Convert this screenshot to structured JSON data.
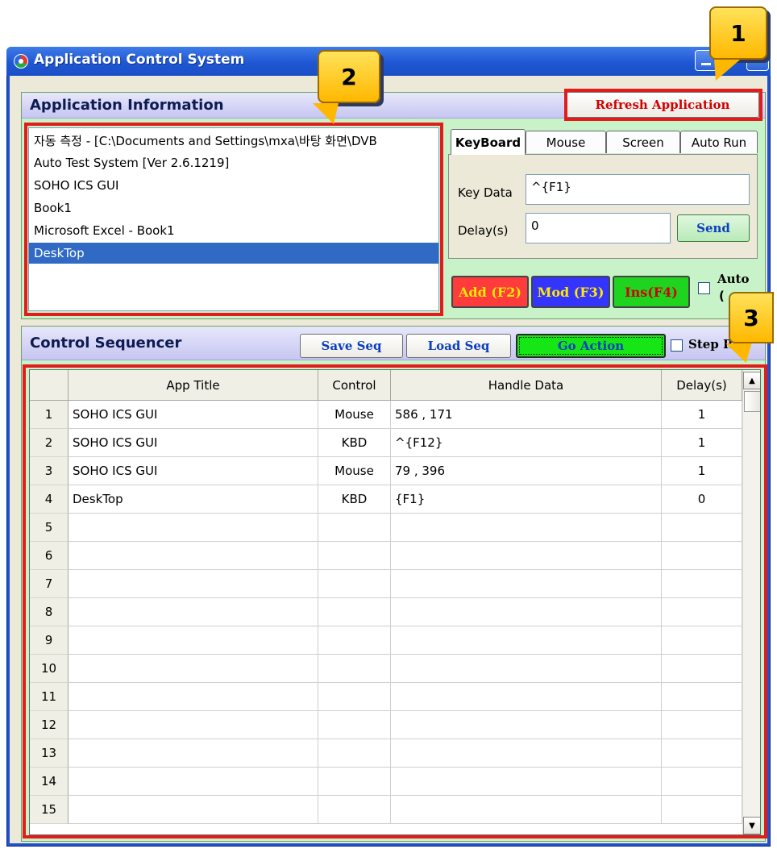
{
  "window": {
    "title": "Application Control System"
  },
  "app_info": {
    "header": "Application Information",
    "refresh_label": "Refresh Application",
    "apps": [
      {
        "label": "자동 측정 - [C:\\Documents and Settings\\mxa\\바탕 화면\\DVB"
      },
      {
        "label": "Auto Test System [Ver 2.6.1219]"
      },
      {
        "label": "SOHO ICS GUI"
      },
      {
        "label": "Book1"
      },
      {
        "label": "Microsoft Excel - Book1"
      },
      {
        "label": "DeskTop",
        "selected": true
      }
    ]
  },
  "tabs": [
    {
      "label": "KeyBoard",
      "active": true
    },
    {
      "label": "Mouse"
    },
    {
      "label": "Screen"
    },
    {
      "label": "Auto Run"
    }
  ],
  "keyboard": {
    "key_data_label": "Key Data",
    "key_data_value": "^{F1}",
    "delay_label": "Delay(s)",
    "delay_value": "0",
    "send_label": "Send"
  },
  "actions": {
    "add_label": "Add (F2)",
    "mod_label": "Mod (F3)",
    "ins_label": "Ins(F4)",
    "auto_label": "Auto",
    "auto_sub": "("
  },
  "sequencer": {
    "header": "Control Sequencer",
    "save_label": "Save Seq",
    "load_label": "Load Seq",
    "go_label": "Go Action",
    "step_label": "Step Run",
    "columns": [
      "App Title",
      "Control",
      "Handle Data",
      "Delay(s)"
    ],
    "rows": [
      {
        "no": "1",
        "app": "SOHO ICS GUI",
        "control": "Mouse",
        "handle": "586 , 171",
        "delay": "1"
      },
      {
        "no": "2",
        "app": "SOHO ICS GUI",
        "control": "KBD",
        "handle": "^{F12}",
        "delay": "1"
      },
      {
        "no": "3",
        "app": "SOHO ICS GUI",
        "control": "Mouse",
        "handle": "79 , 396",
        "delay": "1"
      },
      {
        "no": "4",
        "app": "DeskTop",
        "control": "KBD",
        "handle": "{F1}",
        "delay": "0"
      },
      {
        "no": "5",
        "app": "",
        "control": "",
        "handle": "",
        "delay": ""
      },
      {
        "no": "6",
        "app": "",
        "control": "",
        "handle": "",
        "delay": ""
      },
      {
        "no": "7",
        "app": "",
        "control": "",
        "handle": "",
        "delay": ""
      },
      {
        "no": "8",
        "app": "",
        "control": "",
        "handle": "",
        "delay": ""
      },
      {
        "no": "9",
        "app": "",
        "control": "",
        "handle": "",
        "delay": ""
      },
      {
        "no": "10",
        "app": "",
        "control": "",
        "handle": "",
        "delay": ""
      },
      {
        "no": "11",
        "app": "",
        "control": "",
        "handle": "",
        "delay": ""
      },
      {
        "no": "12",
        "app": "",
        "control": "",
        "handle": "",
        "delay": ""
      },
      {
        "no": "13",
        "app": "",
        "control": "",
        "handle": "",
        "delay": ""
      },
      {
        "no": "14",
        "app": "",
        "control": "",
        "handle": "",
        "delay": ""
      },
      {
        "no": "15",
        "app": "",
        "control": "",
        "handle": "",
        "delay": ""
      }
    ]
  },
  "callouts": [
    "1",
    "2",
    "3"
  ],
  "colors": {
    "highlight_red": "#e31b1b",
    "callout_yellow": "#ffd21f",
    "selection_blue": "#316ac5",
    "panel_green": "#c8f3c8"
  }
}
